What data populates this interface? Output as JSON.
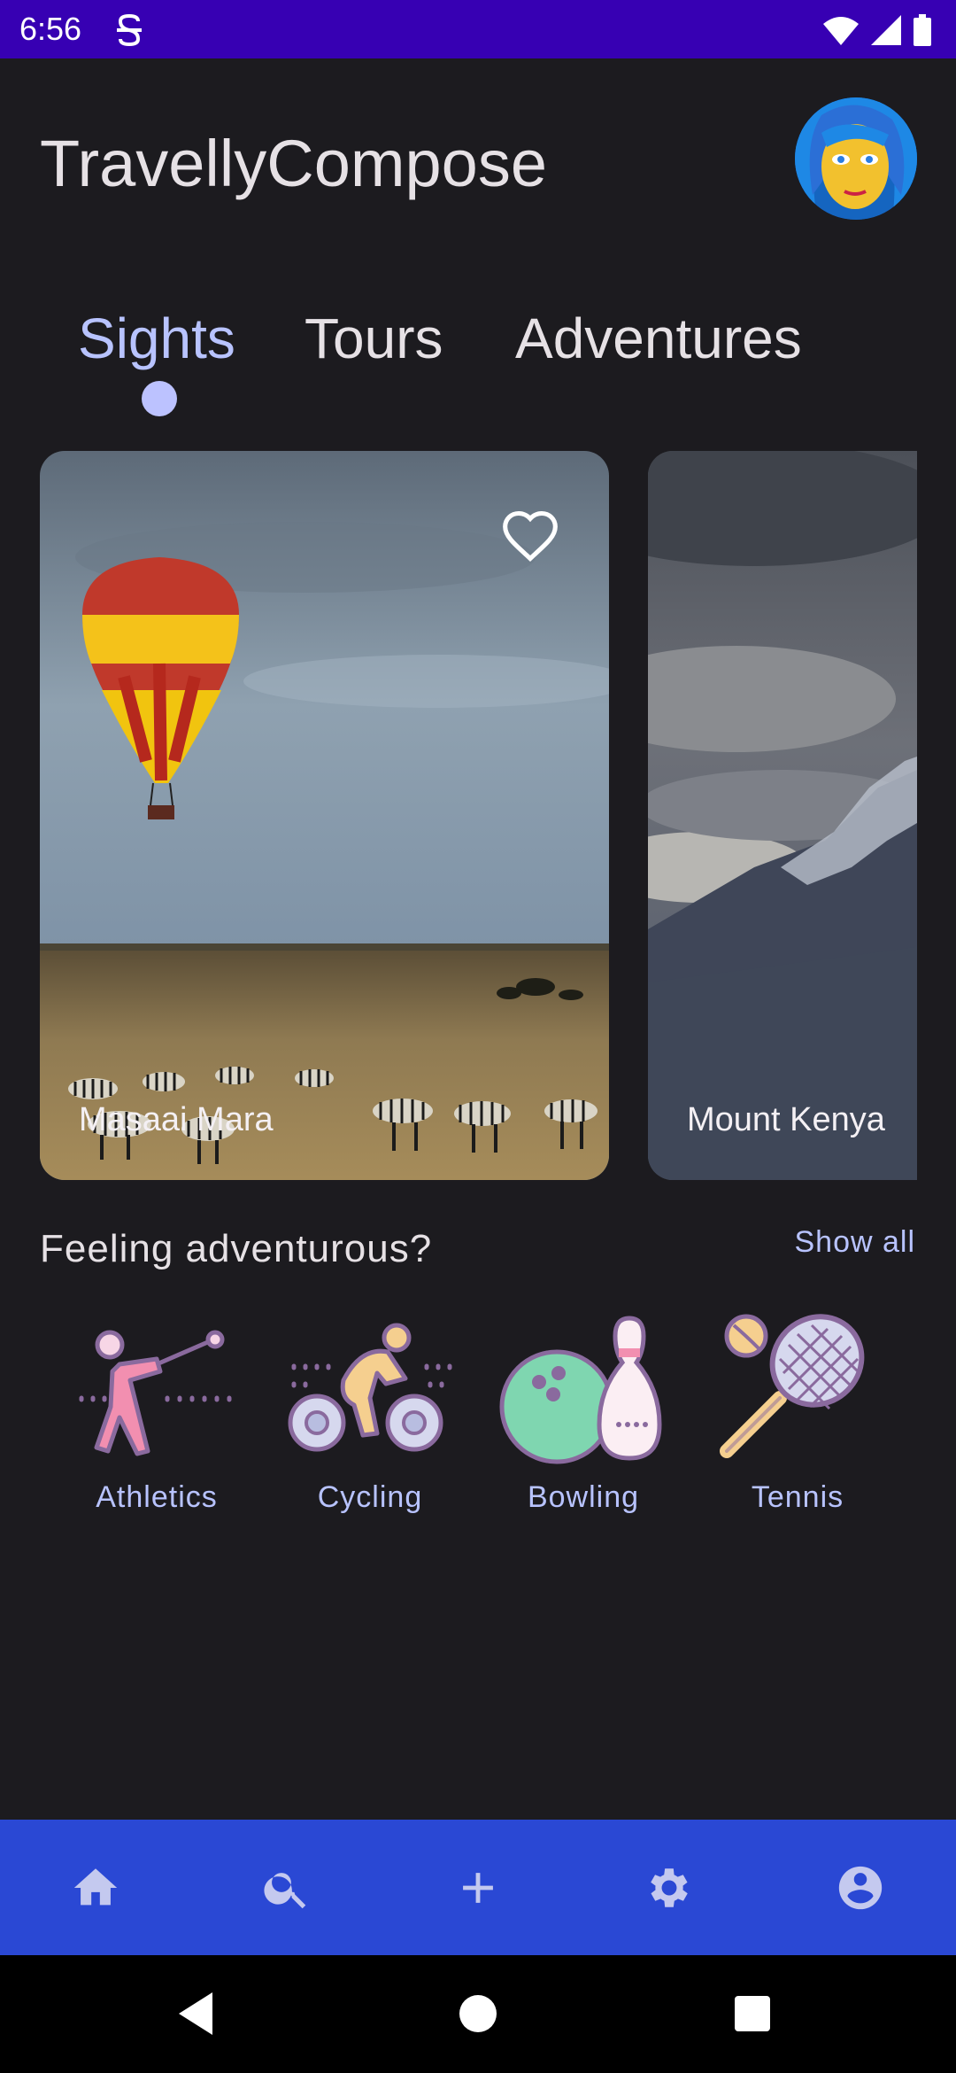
{
  "status_bar": {
    "time": "6:56"
  },
  "header": {
    "title": "TravellyCompose"
  },
  "tabs": [
    {
      "label": "Sights",
      "active": true
    },
    {
      "label": "Tours",
      "active": false
    },
    {
      "label": "Adventures",
      "active": false
    }
  ],
  "cards": [
    {
      "label": "Masaai Mara",
      "favorite_icon": "heart-outline-icon"
    },
    {
      "label": "Mount Kenya"
    }
  ],
  "adventurous": {
    "title": "Feeling adventurous?",
    "show_all": "Show all",
    "items": [
      {
        "label": "Athletics",
        "icon": "athletics-icon"
      },
      {
        "label": "Cycling",
        "icon": "cycling-icon"
      },
      {
        "label": "Bowling",
        "icon": "bowling-icon"
      },
      {
        "label": "Tennis",
        "icon": "tennis-icon"
      }
    ]
  },
  "bottom_nav": {
    "items": [
      "home-icon",
      "search-icon",
      "add-icon",
      "settings-icon",
      "account-icon"
    ]
  },
  "colors": {
    "background": "#1c1b1f",
    "status_bar": "#3700b3",
    "bottom_nav": "#2a48d4",
    "accent": "#b8c3ff"
  }
}
